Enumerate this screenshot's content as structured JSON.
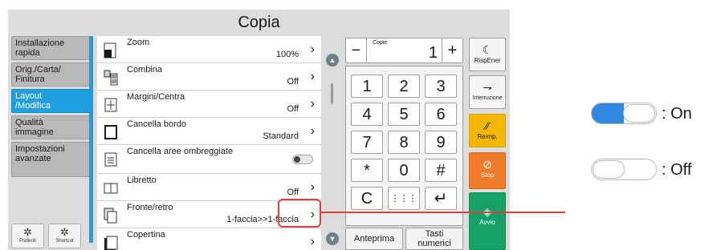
{
  "window": {
    "title": "Copia"
  },
  "nav": {
    "items": [
      {
        "label": "Installazione\nrapida",
        "active": false
      },
      {
        "label": "Orig./Carta/\nFinitura",
        "active": false
      },
      {
        "label": "Layout\n/Modifica",
        "active": true
      },
      {
        "label": "Qualità\nimmagine",
        "active": false
      },
      {
        "label": "Impostazioni\navanzate",
        "active": false
      }
    ],
    "favorites_label": "Preferiti",
    "shortcut_label": "Shortcut"
  },
  "functions": [
    {
      "name": "Zoom",
      "value": "100%",
      "icon": "zoom-icon"
    },
    {
      "name": "Combina",
      "value": "Off",
      "icon": "combine-icon"
    },
    {
      "name": "Margini/Centra",
      "value": "Off",
      "icon": "margin-icon"
    },
    {
      "name": "Cancella bordo",
      "value": "Standard",
      "icon": "border-erase-icon"
    },
    {
      "name": "Cancella aree ombreggiate",
      "value": "",
      "icon": "shadow-erase-icon",
      "toggle": "off"
    },
    {
      "name": "Libretto",
      "value": "Off",
      "icon": "booklet-icon"
    },
    {
      "name": "Fronte/retro",
      "value": "1-faccia>>1-faccia",
      "icon": "duplex-icon"
    },
    {
      "name": "Copertina",
      "value": "",
      "icon": "cover-icon"
    }
  ],
  "copies": {
    "label": "Copie",
    "value": "1",
    "minus": "−",
    "plus": "+"
  },
  "keypad": {
    "keys": [
      "1",
      "2",
      "3",
      "4",
      "5",
      "6",
      "7",
      "8",
      "9",
      "*",
      "0",
      "#",
      "C",
      "⋮⋮⋮",
      "↵"
    ]
  },
  "bottom": {
    "preview": "Anteprima",
    "numeric_keys": "Tasti\nnumerici"
  },
  "side": {
    "energy_saver": "RispEner",
    "interrupt": "Interruzione",
    "reset": "Reimp.",
    "stop": "Stop",
    "start": "Avvio"
  },
  "legend": {
    "on": ": On",
    "off": ": Off"
  },
  "colors": {
    "accent": "#1f9ee0",
    "reset": "#f5b800",
    "stop": "#f07c2b",
    "start": "#16a06a",
    "callout": "#e0403a"
  }
}
